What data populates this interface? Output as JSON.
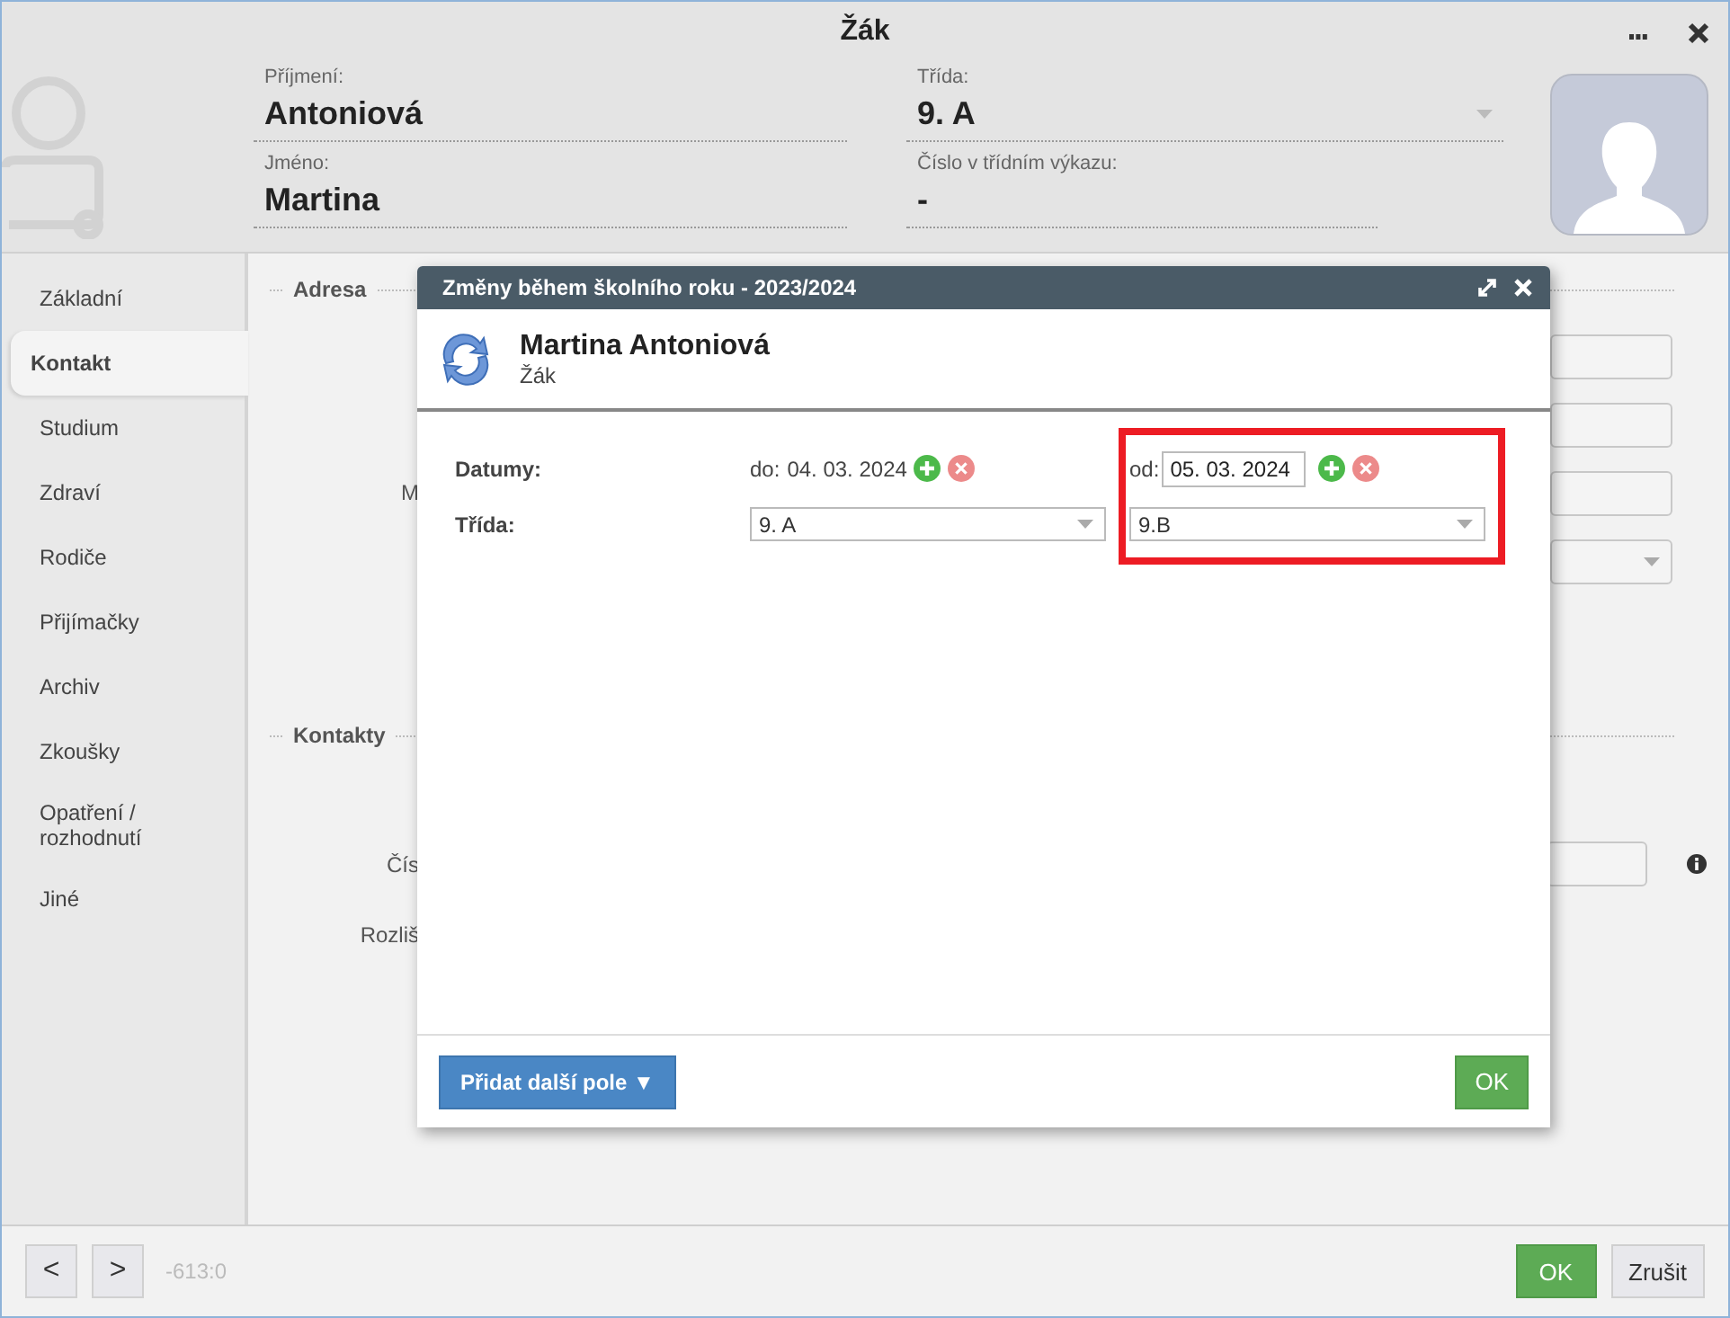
{
  "window": {
    "title": "Žák"
  },
  "header": {
    "fields": [
      {
        "label": "Příjmení:",
        "value": "Antoniová",
        "dropdown": false
      },
      {
        "label": "Třída:",
        "value": "9. A",
        "dropdown": true
      },
      {
        "label": "Jméno:",
        "value": "Martina",
        "dropdown": false
      },
      {
        "label": "Číslo v třídním výkazu:",
        "value": "-",
        "dropdown": false
      }
    ]
  },
  "sidebar": {
    "items": [
      {
        "label": "Základní",
        "selected": false
      },
      {
        "label": "Kontakt",
        "selected": true
      },
      {
        "label": "Studium",
        "selected": false
      },
      {
        "label": "Zdraví",
        "selected": false
      },
      {
        "label": "Rodiče",
        "selected": false
      },
      {
        "label": "Přijímačky",
        "selected": false
      },
      {
        "label": "Archiv",
        "selected": false
      },
      {
        "label": "Zkoušky",
        "selected": false
      },
      {
        "label": "Opatření / rozhodnutí",
        "selected": false
      },
      {
        "label": "Jiné",
        "selected": false
      }
    ]
  },
  "content": {
    "sections": [
      {
        "title": "Adresa",
        "rows": [
          {
            "label": "",
            "kind": "input"
          },
          {
            "label": "",
            "kind": "input"
          },
          {
            "label": "M",
            "kind": "input"
          },
          {
            "label": "",
            "kind": "select"
          }
        ]
      },
      {
        "title": "Kontakty",
        "rows": [
          {
            "label": "Čís",
            "kind": "input-info"
          },
          {
            "label": "Rozliš",
            "kind": "none"
          }
        ]
      }
    ]
  },
  "modal": {
    "title": "Změny během školního roku - 2023/2024",
    "person": {
      "name": "Martina Antoniová",
      "role": "Žák"
    },
    "row_labels": [
      "Datumy:",
      "Třída:"
    ],
    "columns": [
      {
        "date_prefix": "do:",
        "date": "04. 03. 2024",
        "kind": "text",
        "class": "9. A",
        "highlighted": false
      },
      {
        "date_prefix": "od:",
        "date": "05. 03. 2024",
        "kind": "input",
        "class": "9.B",
        "highlighted": true
      }
    ],
    "add_button": "Přidat další pole ▼",
    "ok_button": "OK"
  },
  "footer": {
    "prev": "<",
    "next": ">",
    "position": "-613:0",
    "ok": "OK",
    "cancel": "Zrušit"
  }
}
